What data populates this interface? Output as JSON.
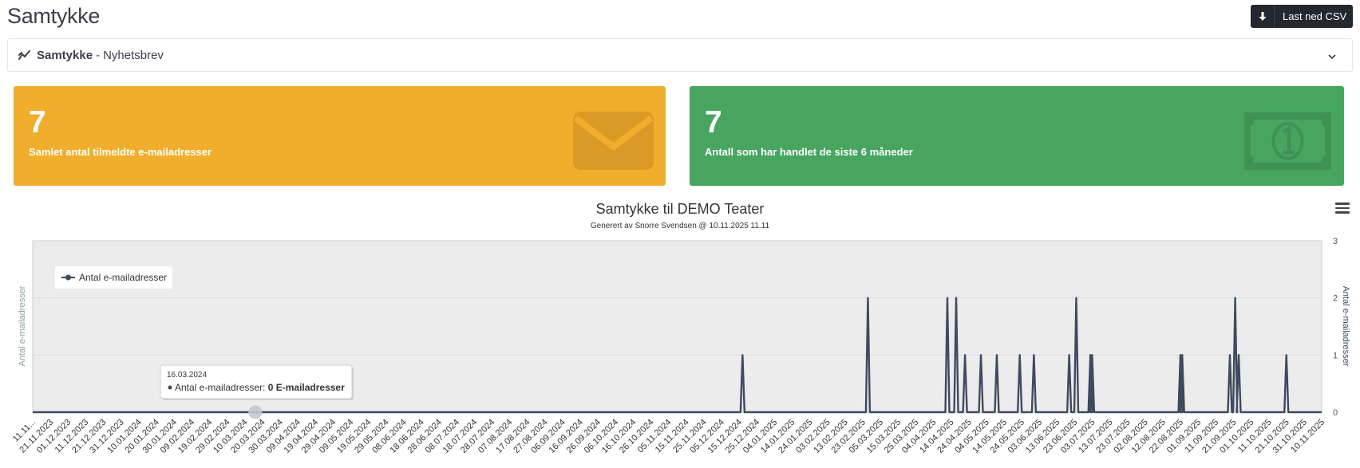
{
  "page": {
    "title": "Samtykke"
  },
  "toolbar": {
    "csv_label": "Last ned CSV"
  },
  "selector": {
    "title": "Samtykke",
    "separator": "-",
    "subtitle": "Nyhetsbrev"
  },
  "cards": [
    {
      "value": "7",
      "caption": "Samlet antal tilmeldte e-mailadresser",
      "color": "#f1ae2c",
      "icon": "envelope-icon"
    },
    {
      "value": "7",
      "caption": "Antall som har handlet de siste 6 måneder",
      "color": "#47a55f",
      "icon": "money-bill-icon"
    }
  ],
  "chart_data": {
    "type": "line",
    "title": "Samtykke til DEMO Teater",
    "subtitle": "Generert av Snorre Svendsen @ 10.11.2025 11.11",
    "ylabel_left": "Antal e-mailadresser",
    "ylabel_right": "Antal e-mailadresser",
    "ylim": [
      0,
      3
    ],
    "yticks": [
      0,
      1,
      2,
      3
    ],
    "grid": true,
    "legend_position": "top-left",
    "x_start": "11.11.2023",
    "x_end": "10.11.2025",
    "xtick_labels": [
      "11.11...",
      "21.11.2023",
      "01.12.2023",
      "11.12.2023",
      "21.12.2023",
      "31.12.2023",
      "10.01.2024",
      "20.01.2024",
      "30.01.2024",
      "09.02.2024",
      "19.02.2024",
      "29.02.2024",
      "10.03.2024",
      "20.03.2024",
      "30.03.2024",
      "09.04.2024",
      "19.04.2024",
      "29.04.2024",
      "09.05.2024",
      "19.05.2024",
      "29.05.2024",
      "08.06.2024",
      "18.06.2024",
      "28.06.2024",
      "08.07.2024",
      "18.07.2024",
      "28.07.2024",
      "07.08.2024",
      "17.08.2024",
      "27.08.2024",
      "06.09.2024",
      "16.09.2024",
      "26.09.2024",
      "06.10.2024",
      "16.10.2024",
      "26.10.2024",
      "05.11.2024",
      "15.11.2024",
      "25.11.2024",
      "05.12.2024",
      "15.12.2024",
      "25.12.2024",
      "04.01.2025",
      "14.01.2025",
      "24.01.2025",
      "03.02.2025",
      "13.02.2025",
      "23.02.2025",
      "05.03.2025",
      "15.03.2025",
      "25.03.2025",
      "04.04.2025",
      "14.04.2025",
      "24.04.2025",
      "04.05.2025",
      "14.05.2025",
      "24.05.2025",
      "03.06.2025",
      "13.06.2025",
      "23.06.2025",
      "03.07.2025",
      "13.07.2025",
      "23.07.2025",
      "02.08.2025",
      "12.08.2025",
      "22.08.2025",
      "01.09.2025",
      "11.09.2025",
      "21.09.2025",
      "01.10.2025",
      "11.10.2025",
      "21.10.2025",
      "31.10.2025",
      "10.11.2025"
    ],
    "series": [
      {
        "name": "Antal e-mailadresser",
        "color": "#3d4a60",
        "baseline": 0,
        "points": [
          {
            "x": "17.12.2024",
            "y": 1
          },
          {
            "x": "26.02.2025",
            "y": 2
          },
          {
            "x": "12.04.2025",
            "y": 2
          },
          {
            "x": "17.04.2025",
            "y": 2
          },
          {
            "x": "22.04.2025",
            "y": 1
          },
          {
            "x": "01.05.2025",
            "y": 1
          },
          {
            "x": "10.05.2025",
            "y": 1
          },
          {
            "x": "23.05.2025",
            "y": 1
          },
          {
            "x": "31.05.2025",
            "y": 1
          },
          {
            "x": "20.06.2025",
            "y": 1
          },
          {
            "x": "24.06.2025",
            "y": 2
          },
          {
            "x": "02.07.2025",
            "y": 1
          },
          {
            "x": "03.07.2025",
            "y": 1
          },
          {
            "x": "22.08.2025",
            "y": 1
          },
          {
            "x": "23.08.2025",
            "y": 1
          },
          {
            "x": "19.09.2025",
            "y": 1
          },
          {
            "x": "22.09.2025",
            "y": 2
          },
          {
            "x": "24.09.2025",
            "y": 1
          },
          {
            "x": "21.10.2025",
            "y": 1
          }
        ]
      }
    ],
    "tooltip": {
      "date": "16.03.2024",
      "series_label": "Antal e-mailadresser:",
      "value_text": "0 E-mailadresser"
    }
  }
}
